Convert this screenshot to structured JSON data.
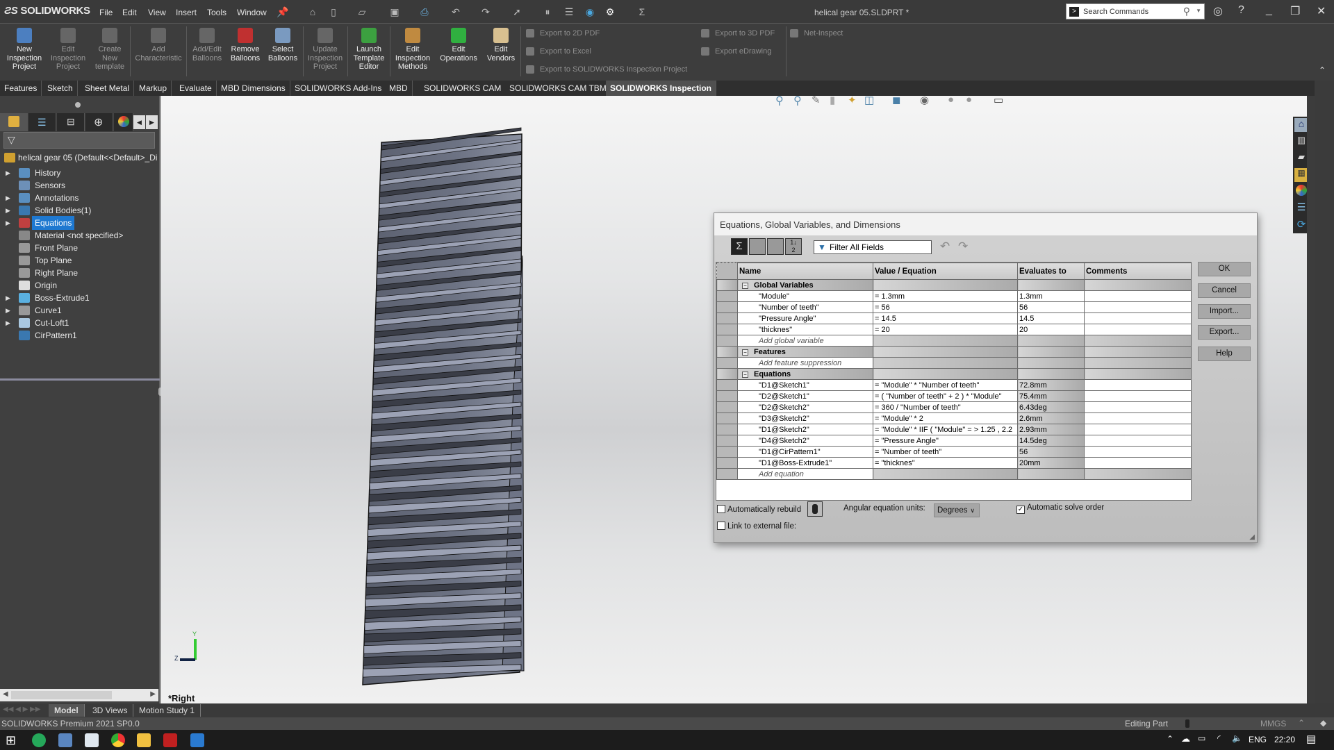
{
  "app": {
    "name": "SOLIDWORKS",
    "document_title": "helical gear 05.SLDPRT *",
    "menu": [
      "File",
      "Edit",
      "View",
      "Insert",
      "Tools",
      "Window"
    ],
    "search_placeholder": "Search Commands"
  },
  "ribbon": {
    "buttons": [
      {
        "label": "New Inspection Project",
        "enabled": true,
        "icon": "new-project-icon"
      },
      {
        "label": "Edit Inspection Project",
        "enabled": false,
        "icon": "edit-project-icon"
      },
      {
        "label": "Create New template",
        "enabled": false,
        "icon": "template-icon"
      },
      {
        "label": "Add Characteristic",
        "enabled": false,
        "icon": "characteristic-icon"
      },
      {
        "label": "Add/Edit Balloons",
        "enabled": false,
        "icon": "balloon-icon"
      },
      {
        "label": "Remove Balloons",
        "enabled": true,
        "icon": "remove-balloon-icon"
      },
      {
        "label": "Select Balloons",
        "enabled": true,
        "icon": "select-balloon-icon"
      },
      {
        "label": "Update Inspection Project",
        "enabled": false,
        "icon": "update-icon"
      },
      {
        "label": "Launch Template Editor",
        "enabled": true,
        "icon": "template-editor-icon"
      },
      {
        "label": "Edit Inspection Methods",
        "enabled": true,
        "icon": "methods-icon"
      },
      {
        "label": "Edit Operations",
        "enabled": true,
        "icon": "operations-icon"
      },
      {
        "label": "Edit Vendors",
        "enabled": true,
        "icon": "vendors-icon"
      }
    ],
    "exports": [
      "Export to 2D PDF",
      "Export to Excel",
      "Export to SOLIDWORKS Inspection Project",
      "Export to 3D PDF",
      "Export eDrawing",
      "Net-Inspect"
    ]
  },
  "tabs": [
    "Features",
    "Sketch",
    "Sheet Metal",
    "Markup",
    "Evaluate",
    "MBD Dimensions",
    "SOLIDWORKS Add-Ins",
    "MBD",
    "SOLIDWORKS CAM",
    "SOLIDWORKS CAM TBM",
    "SOLIDWORKS Inspection"
  ],
  "active_tab": "SOLIDWORKS Inspection",
  "feature_tree": {
    "root": "helical gear 05  (Default<<Default>_Di",
    "items": [
      {
        "label": "History",
        "expandable": true
      },
      {
        "label": "Sensors",
        "expandable": false
      },
      {
        "label": "Annotations",
        "expandable": true
      },
      {
        "label": "Solid Bodies(1)",
        "expandable": true
      },
      {
        "label": "Equations",
        "expandable": true,
        "selected": true
      },
      {
        "label": "Material <not specified>",
        "expandable": false
      },
      {
        "label": "Front Plane",
        "expandable": false
      },
      {
        "label": "Top Plane",
        "expandable": false
      },
      {
        "label": "Right Plane",
        "expandable": false
      },
      {
        "label": "Origin",
        "expandable": false
      },
      {
        "label": "Boss-Extrude1",
        "expandable": true
      },
      {
        "label": "Curve1",
        "expandable": true
      },
      {
        "label": "Cut-Loft1",
        "expandable": true
      },
      {
        "label": "CirPattern1",
        "expandable": false
      }
    ]
  },
  "viewport": {
    "view_name": "*Right",
    "axis_labels": [
      "Y",
      "Z"
    ]
  },
  "dialog": {
    "title": "Equations, Global Variables, and Dimensions",
    "filter_placeholder": "Filter All Fields",
    "columns": [
      "Name",
      "Value / Equation",
      "Evaluates to",
      "Comments"
    ],
    "sections": {
      "global_variables": {
        "label": "Global Variables",
        "rows": [
          {
            "name": "\"Module\"",
            "value": "= 1.3mm",
            "evaluates": "1.3mm",
            "comment": ""
          },
          {
            "name": "\"Number of teeth\"",
            "value": "= 56",
            "evaluates": "56",
            "comment": ""
          },
          {
            "name": "\"Pressure Angle\"",
            "value": "= 14.5",
            "evaluates": "14.5",
            "comment": ""
          },
          {
            "name": "\"thicknes\"",
            "value": "= 20",
            "evaluates": "20",
            "comment": ""
          }
        ],
        "add_label": "Add global variable"
      },
      "features": {
        "label": "Features",
        "add_label": "Add feature suppression"
      },
      "equations": {
        "label": "Equations",
        "rows": [
          {
            "name": "\"D1@Sketch1\"",
            "value": "= \"Module\" * \"Number of teeth\"",
            "evaluates": "72.8mm",
            "comment": ""
          },
          {
            "name": "\"D2@Sketch1\"",
            "value": "= ( \"Number of teeth\" + 2 ) * \"Module\"",
            "evaluates": "75.4mm",
            "comment": ""
          },
          {
            "name": "\"D2@Sketch2\"",
            "value": "= 360 / \"Number of teeth\"",
            "evaluates": "6.43deg",
            "comment": ""
          },
          {
            "name": "\"D3@Sketch2\"",
            "value": "= \"Module\" * 2",
            "evaluates": "2.6mm",
            "comment": ""
          },
          {
            "name": "\"D1@Sketch2\"",
            "value": "= \"Module\" * IIF ( \"Module\" = > 1.25 , 2.2",
            "evaluates": "2.93mm",
            "comment": ""
          },
          {
            "name": "\"D4@Sketch2\"",
            "value": "= \"Pressure Angle\"",
            "evaluates": "14.5deg",
            "comment": ""
          },
          {
            "name": "\"D1@CirPattern1\"",
            "value": "= \"Number of teeth\"",
            "evaluates": "56",
            "comment": ""
          },
          {
            "name": "\"D1@Boss-Extrude1\"",
            "value": "= \"thicknes\"",
            "evaluates": "20mm",
            "comment": ""
          }
        ],
        "add_label": "Add equation"
      }
    },
    "buttons": {
      "ok": "OK",
      "cancel": "Cancel",
      "import": "Import...",
      "export": "Export...",
      "help": "Help"
    },
    "options": {
      "auto_rebuild_label": "Automatically rebuild",
      "auto_rebuild": false,
      "angular_units_label": "Angular equation units:",
      "angular_units": "Degrees",
      "auto_solve_label": "Automatic solve order",
      "auto_solve": true,
      "link_external_label": "Link to external file:",
      "link_external": false
    }
  },
  "bottom_tabs": [
    "Model",
    "3D Views",
    "Motion Study 1"
  ],
  "status": {
    "product": "SOLIDWORKS Premium 2021 SP0.0",
    "mode": "Editing Part",
    "units": "MMGS"
  },
  "taskbar": {
    "language": "ENG",
    "time": "22:20"
  }
}
